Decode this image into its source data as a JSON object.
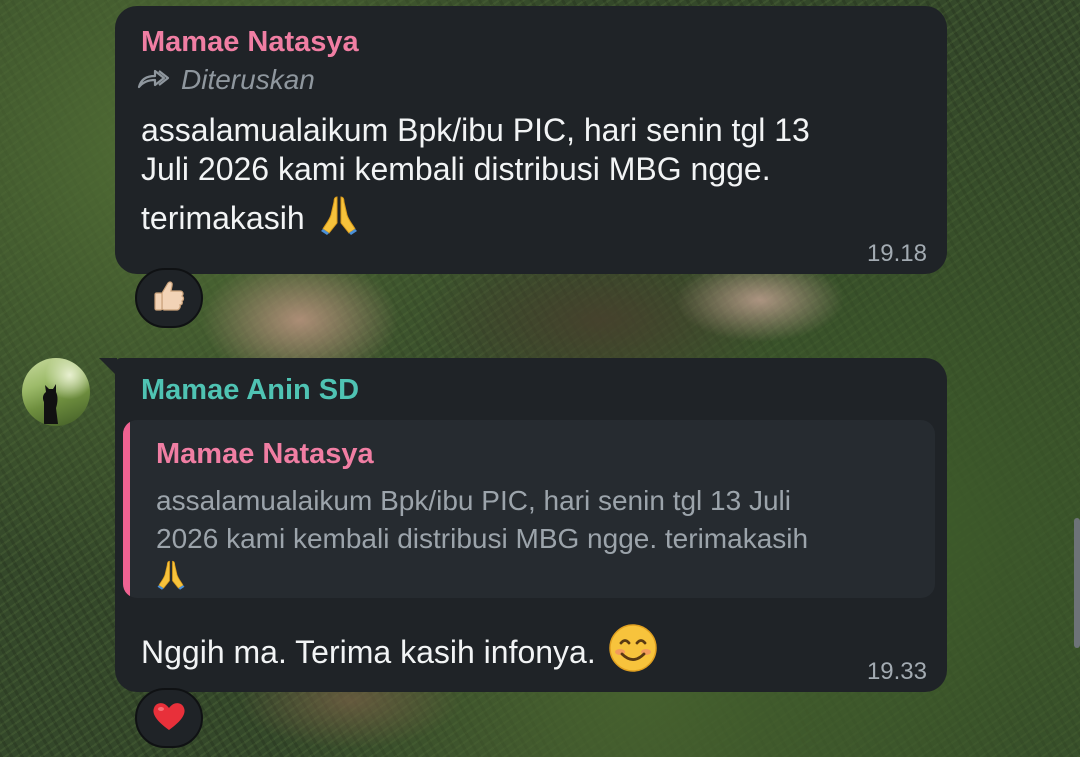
{
  "messages": [
    {
      "sender": "Mamae Natasya",
      "sender_color": "#f07ea3",
      "forwarded_label": "Diteruskan",
      "text_lines": [
        "assalamualaikum Bpk/ibu PIC, hari senin tgl 13",
        "Juli 2026 kami kembali distribusi MBG ngge.",
        "terimakasih"
      ],
      "time": "19.18",
      "reaction": "thumbs-up"
    },
    {
      "sender": "Mamae Anin SD",
      "sender_color": "#4fc3b3",
      "reply": {
        "sender": "Mamae Natasya",
        "text_lines": [
          "assalamualaikum Bpk/ibu PIC, hari senin tgl 13 Juli",
          "2026 kami kembali distribusi MBG ngge. terimakasih"
        ]
      },
      "text": "Nggih ma. Terima kasih infonya.",
      "time": "19.33",
      "reaction": "red-heart"
    }
  ]
}
